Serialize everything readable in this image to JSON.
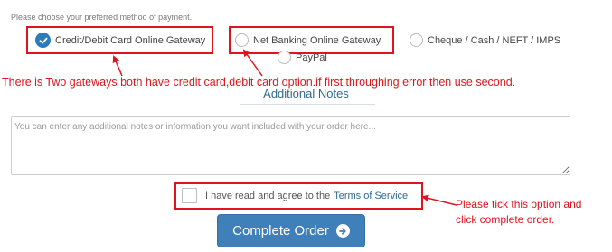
{
  "payment": {
    "prompt": "Please choose your preferred method of payment.",
    "options": [
      {
        "label": "Credit/Debit Card Online Gateway",
        "selected": true
      },
      {
        "label": "Net Banking Online Gateway",
        "selected": false
      },
      {
        "label": "Cheque / Cash / NEFT / IMPS",
        "selected": false
      },
      {
        "label": "PayPal",
        "selected": false
      }
    ]
  },
  "annotations": {
    "gateways_note": "There is Two gateways both have credit card,debit card option.if first throughing error then use second.",
    "tick_note_line1": "Please tick this option and",
    "tick_note_line2": "click complete order."
  },
  "notes": {
    "heading": "Additional Notes",
    "placeholder": "You can enter any additional notes or information you want included with your order here..."
  },
  "tos": {
    "text": "I have read and agree to the",
    "link": "Terms of Service"
  },
  "complete_button": {
    "label": "Complete Order"
  },
  "colors": {
    "annotation_red": "#e0141e",
    "accent_blue": "#3f7fba",
    "link_blue": "#2f6a96"
  }
}
